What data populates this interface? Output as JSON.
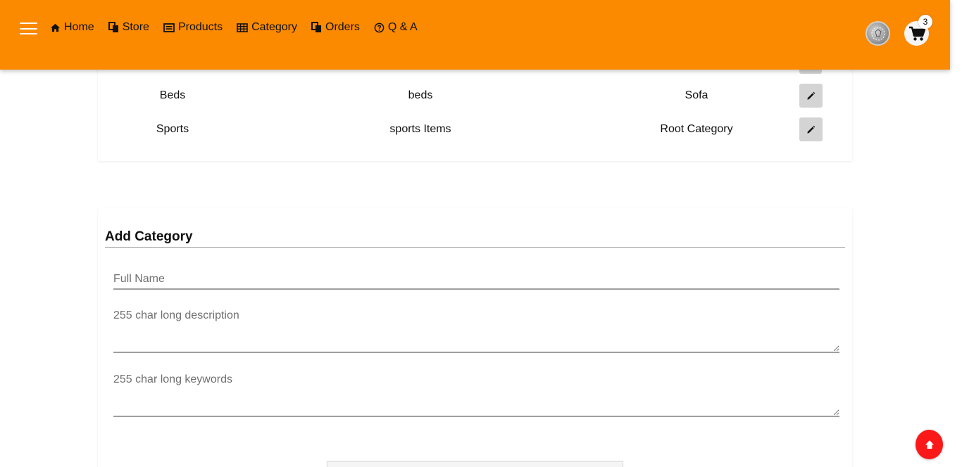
{
  "nav": {
    "links": [
      {
        "label": "Home",
        "icon": "home-icon"
      },
      {
        "label": "Store",
        "icon": "store-icon"
      },
      {
        "label": "Products",
        "icon": "products-icon"
      },
      {
        "label": "Category",
        "icon": "table-icon"
      },
      {
        "label": "Orders",
        "icon": "orders-icon"
      },
      {
        "label": "Q & A",
        "icon": "question-circle-icon"
      }
    ],
    "cart_count": "3",
    "accent_color": "#fb8a00"
  },
  "categories": {
    "rows": [
      {
        "name": "Beds",
        "description": "beds",
        "parent": "Sofa"
      },
      {
        "name": "Sports",
        "description": "sports Items",
        "parent": "Root Category"
      }
    ]
  },
  "form": {
    "title": "Add Category",
    "name_placeholder": "Full Name",
    "description_placeholder": "255 char long description",
    "keywords_placeholder": "255 char long keywords"
  },
  "scroll_top": {
    "color": "#fb1818"
  }
}
